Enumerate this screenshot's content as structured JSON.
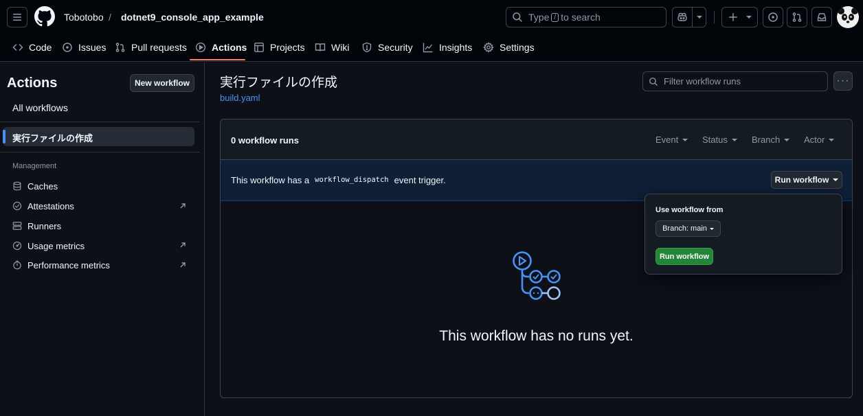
{
  "header": {
    "owner": "Tobotobo",
    "separator": "/",
    "repo": "dotnet9_console_app_example",
    "search": {
      "prefix": "Type",
      "key": "/",
      "suffix": "to search"
    }
  },
  "tabs": [
    {
      "label": "Code",
      "icon": "code-icon"
    },
    {
      "label": "Issues",
      "icon": "issue-opened-icon"
    },
    {
      "label": "Pull requests",
      "icon": "git-pull-request-icon"
    },
    {
      "label": "Actions",
      "icon": "play-icon",
      "active": true
    },
    {
      "label": "Projects",
      "icon": "table-icon"
    },
    {
      "label": "Wiki",
      "icon": "book-icon"
    },
    {
      "label": "Security",
      "icon": "shield-icon"
    },
    {
      "label": "Insights",
      "icon": "graph-icon"
    },
    {
      "label": "Settings",
      "icon": "gear-icon"
    }
  ],
  "sidebar": {
    "title": "Actions",
    "new_workflow_label": "New workflow",
    "all_workflows_label": "All workflows",
    "selected_workflow": "実行ファイルの作成",
    "management_heading": "Management",
    "management_items": [
      {
        "label": "Caches",
        "icon": "database-icon"
      },
      {
        "label": "Attestations",
        "icon": "verified-icon",
        "external": true
      },
      {
        "label": "Runners",
        "icon": "server-icon"
      },
      {
        "label": "Usage metrics",
        "icon": "meter-icon",
        "external": true
      },
      {
        "label": "Performance metrics",
        "icon": "stopwatch-icon",
        "external": true
      }
    ]
  },
  "main": {
    "title": "実行ファイルの作成",
    "file_link": "build.yaml",
    "filter_placeholder": "Filter workflow runs",
    "kebab": "···",
    "runs_count": "0 workflow runs",
    "filters": [
      "Event",
      "Status",
      "Branch",
      "Actor"
    ],
    "banner": {
      "before": "This workflow has a",
      "code": "workflow_dispatch",
      "after": "event trigger."
    },
    "run_workflow_label": "Run workflow",
    "empty_message": "This workflow has no runs yet."
  },
  "popover": {
    "label": "Use workflow from",
    "branch_label": "Branch: main",
    "run_button_label": "Run workflow"
  },
  "colors": {
    "accent": "#4493f8",
    "tab_underline": "#f78166",
    "run_green": "#238636",
    "background": "#0d1117"
  }
}
